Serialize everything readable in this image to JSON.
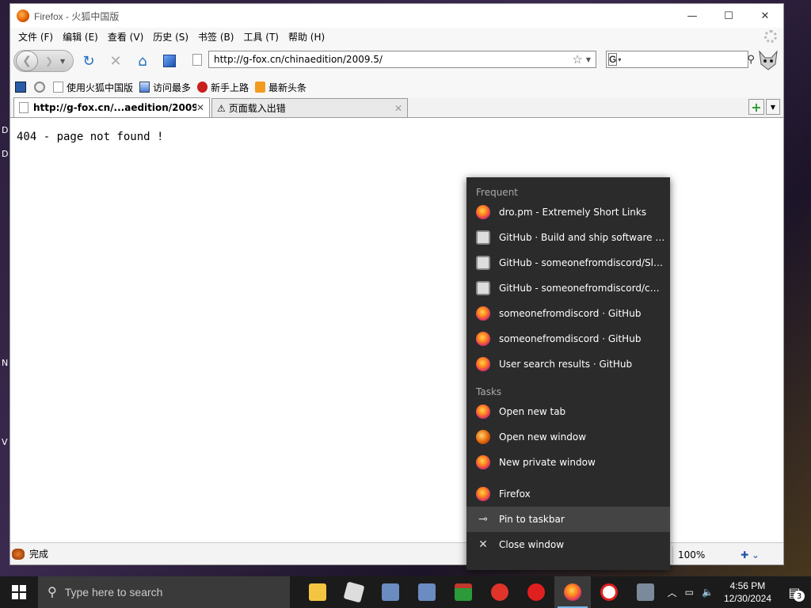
{
  "window": {
    "title": "Firefox - 火狐中国版"
  },
  "menu": [
    "文件 (F)",
    "编辑 (E)",
    "查看 (V)",
    "历史 (S)",
    "书签 (B)",
    "工具 (T)",
    "帮助 (H)"
  ],
  "nav": {
    "url": "http://g-fox.cn/chinaedition/2009.5/",
    "search_placeholder": ""
  },
  "bookmarks": [
    "使用火狐中国版",
    "访问最多",
    "新手上路",
    "最新头条"
  ],
  "tabs": [
    {
      "label": "http://g-fox.cn/...aedition/2009.5/",
      "active": true
    },
    {
      "label": "页面载入出错",
      "active": false
    }
  ],
  "content": {
    "text": "404 - page not found !"
  },
  "status": {
    "text": "完成",
    "zoom": "100%"
  },
  "jumplist": {
    "frequent_header": "Frequent",
    "frequent": [
      {
        "label": "dro.pm - Extremely Short Links",
        "icon": "firefox"
      },
      {
        "label": "GitHub · Build and ship software on a s...",
        "icon": "github"
      },
      {
        "label": "GitHub - someonefromdiscord/SlideTo...",
        "icon": "github"
      },
      {
        "label": "GitHub - someonefromdiscord/cuddly...",
        "icon": "github"
      },
      {
        "label": "someonefromdiscord · GitHub",
        "icon": "firefox"
      },
      {
        "label": "someonefromdiscord · GitHub",
        "icon": "firefox"
      },
      {
        "label": "User search results · GitHub",
        "icon": "firefox"
      }
    ],
    "tasks_header": "Tasks",
    "tasks": [
      "Open new tab",
      "Open new window",
      "New private window"
    ],
    "app_name": "Firefox",
    "pin": "Pin to taskbar",
    "close": "Close window"
  },
  "taskbar": {
    "search_placeholder": "Type here to search",
    "time": "4:56 PM",
    "date": "12/30/2024",
    "notifications": "3"
  }
}
